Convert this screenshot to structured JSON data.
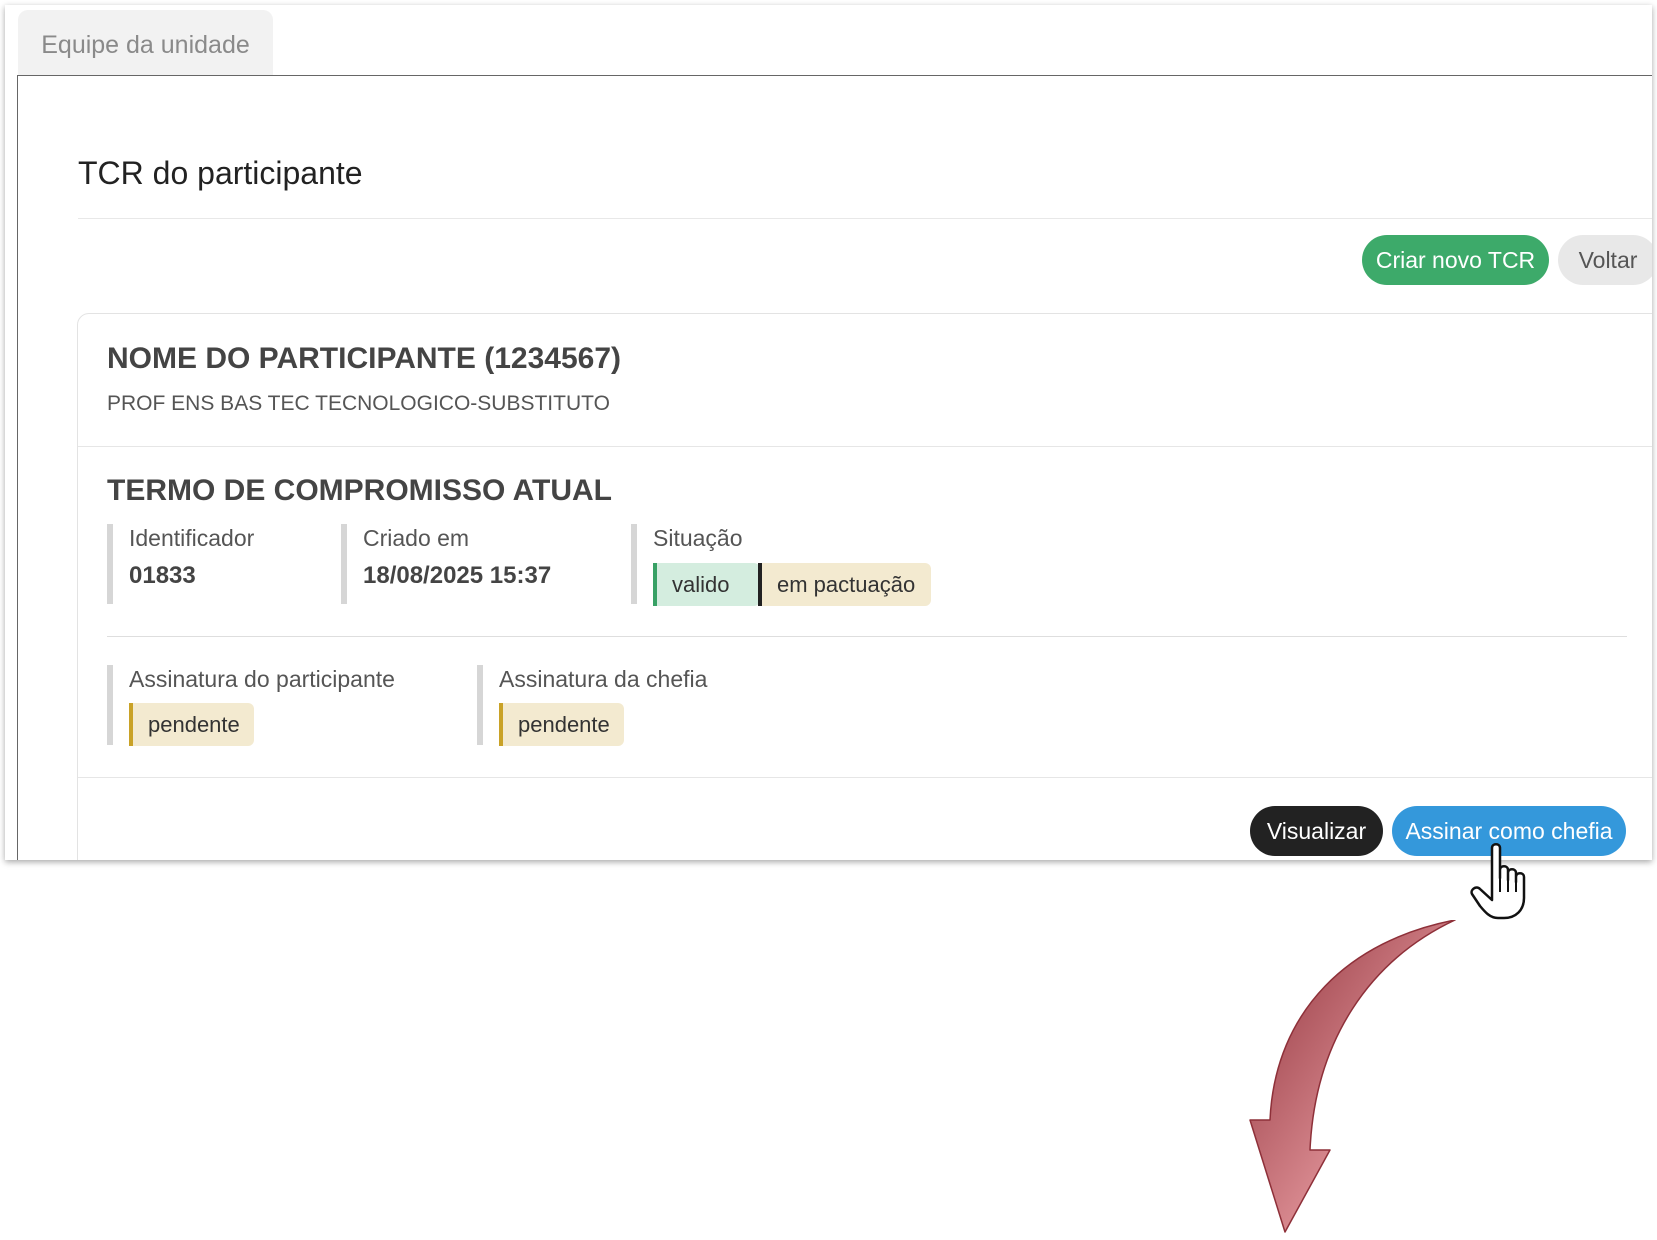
{
  "tabs": {
    "team": "Equipe da unidade"
  },
  "page": {
    "title": "TCR do participante"
  },
  "actions": {
    "create": "Criar novo TCR",
    "back": "Voltar"
  },
  "participant": {
    "name": "NOME DO PARTICIPANTE (1234567)",
    "role": "PROF ENS BAS TEC TECNOLOGICO-SUBSTITUTO"
  },
  "term": {
    "title": "TERMO DE COMPROMISSO ATUAL",
    "id_label": "Identificador",
    "id_value": "01833",
    "created_label": "Criado em",
    "created_value": "18/08/2025 15:37",
    "status_label": "Situação",
    "status_badges": [
      "valido",
      "em pactuação"
    ],
    "participant_sig_label": "Assinatura do participante",
    "participant_sig_value": "pendente",
    "chief_sig_label": "Assinatura da chefia",
    "chief_sig_value": "pendente"
  },
  "footer": {
    "view": "Visualizar",
    "sign": "Assinar como chefia"
  },
  "colors": {
    "create": "#3daa6a",
    "sign": "#3498db",
    "view": "#222222",
    "arrow": "#c0666e"
  },
  "icons": {
    "cursor": "hand-pointer-icon",
    "arrow": "curved-arrow-down-icon"
  }
}
